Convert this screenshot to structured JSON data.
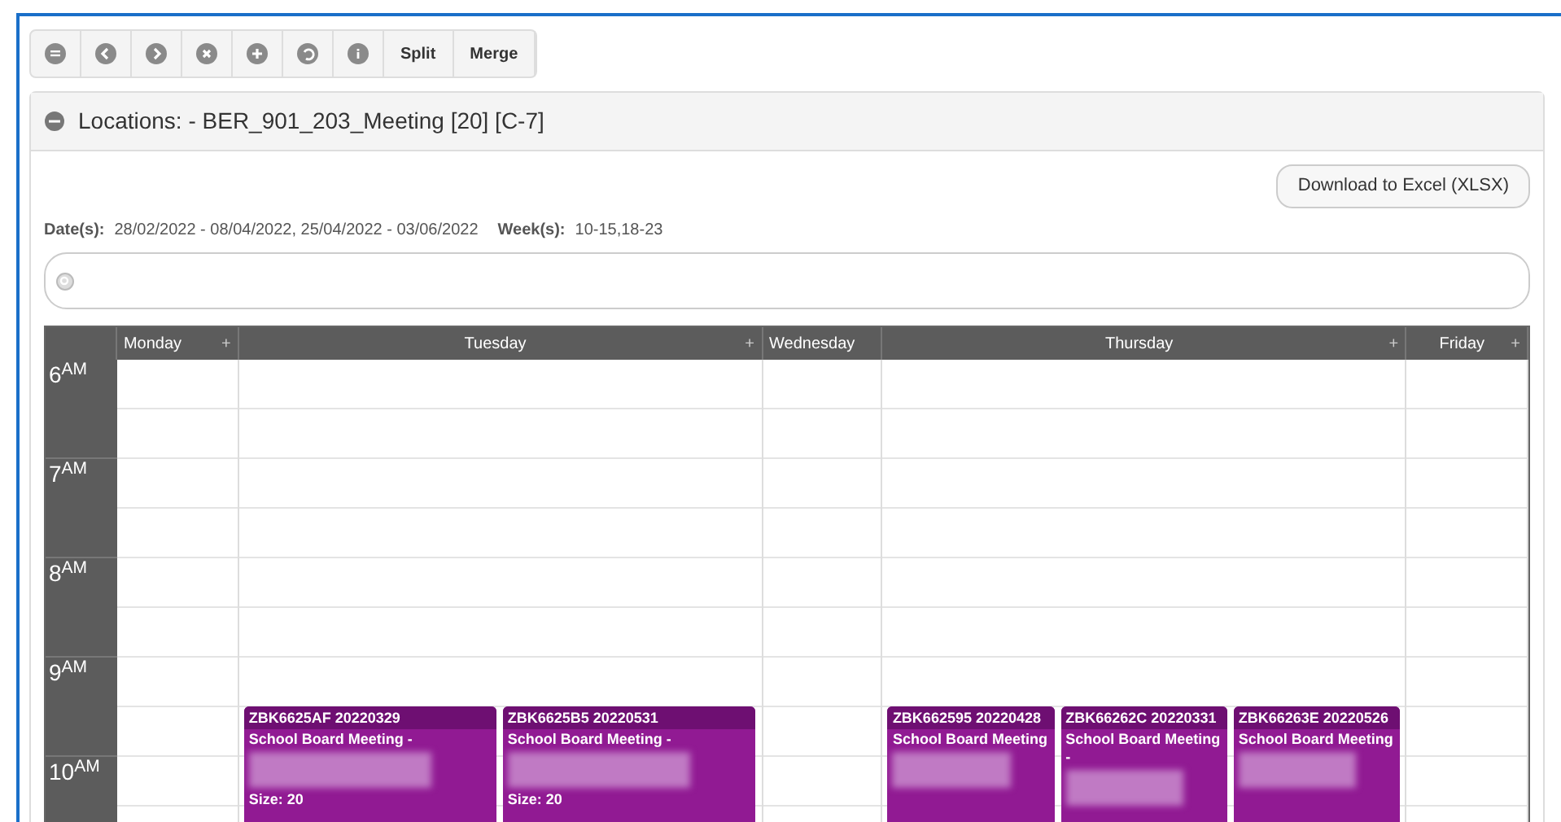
{
  "toolbar": [
    {
      "kind": "icon"
    },
    {
      "kind": "icon"
    },
    {
      "kind": "icon"
    },
    {
      "kind": "icon"
    },
    {
      "kind": "icon"
    },
    {
      "kind": "icon"
    },
    {
      "kind": "icon"
    },
    {
      "kind": "text",
      "label": "Split"
    },
    {
      "kind": "text",
      "label": "Merge"
    }
  ],
  "panel": {
    "title": "Locations: - BER_901_203_Meeting [20] [C-7]",
    "expanded": true
  },
  "download_button": "Download to Excel (XLSX)",
  "dates_label": "Date(s):",
  "dates": "28/02/2022 - 08/04/2022, 25/04/2022 - 03/06/2022",
  "weeks_label": "Week(s):",
  "weeks": "10-15,18-23",
  "calendar": {
    "days": [
      {
        "name": "Monday",
        "add": "+"
      },
      {
        "name": "Tuesday",
        "add": "+",
        "events": [
          {
            "code": "ZBK6625AF 20220329",
            "title": "School Board Meeting -",
            "size": "Size: 20"
          },
          {
            "code": "ZBK6625B5 20220531",
            "title": "School Board Meeting -",
            "size": "Size: 20"
          }
        ]
      },
      {
        "name": "Wednesday"
      },
      {
        "name": "Thursday",
        "add": "+",
        "events": [
          {
            "code": "ZBK662595 20220428",
            "title": "School Board Meeting"
          },
          {
            "code": "ZBK66262C 20220331",
            "title": "School Board Meeting -"
          },
          {
            "code": "ZBK66263E 20220526",
            "title": "School Board Meeting"
          }
        ]
      },
      {
        "name": "Friday",
        "add": "+"
      }
    ],
    "hours": [
      "6$^{AM}$",
      "7$^{AM}$",
      "8$^{AM}$",
      "9$^{AM}$",
      "10$^{AM}$"
    ]
  }
}
